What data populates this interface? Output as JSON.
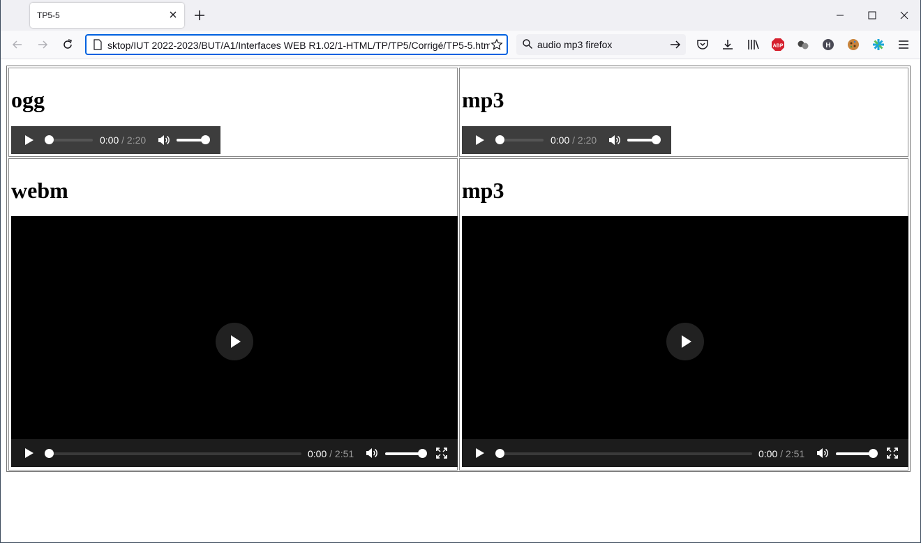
{
  "browser": {
    "tab_title": "TP5-5",
    "url": "sktop/IUT 2022-2023/BUT/A1/Interfaces WEB R1.02/1-HTML/TP/TP5/Corrigé/TP5-5.html",
    "search_value": "audio mp3 firefox",
    "accent_color": "#0061e0"
  },
  "page": {
    "cells": [
      {
        "heading": "ogg",
        "player": "audio",
        "current_time": "0:00",
        "duration": "/ 2:20"
      },
      {
        "heading": "mp3",
        "player": "audio",
        "current_time": "0:00",
        "duration": "/ 2:20"
      },
      {
        "heading": "webm",
        "player": "video",
        "current_time": "0:00",
        "duration": "/ 2:51"
      },
      {
        "heading": "mp3",
        "player": "video",
        "current_time": "0:00",
        "duration": "/ 2:51"
      }
    ]
  }
}
